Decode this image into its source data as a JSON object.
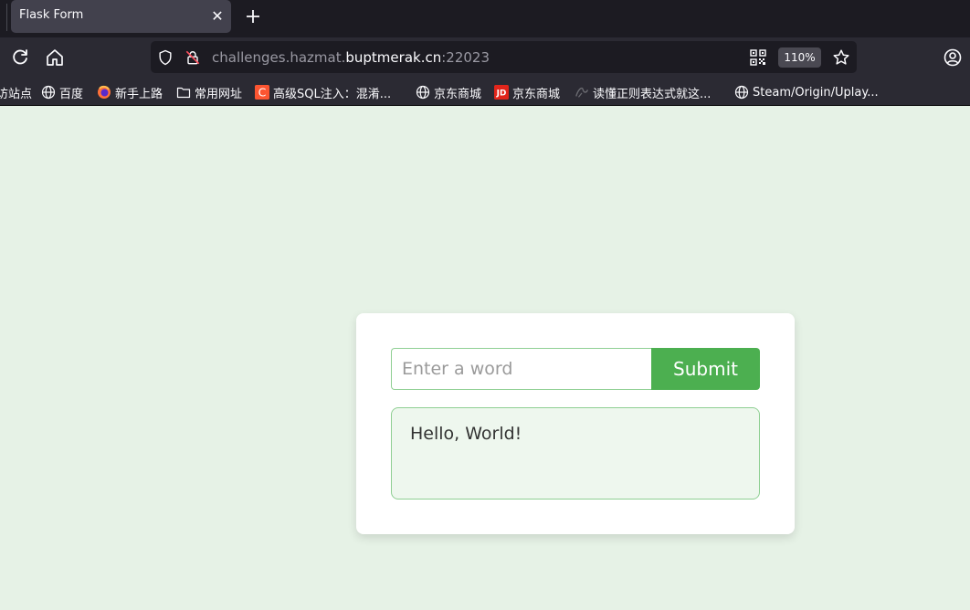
{
  "browser": {
    "tab_title": "Flask Form",
    "tab_close_glyph": "✕",
    "url": {
      "prefix": "challenges.hazmat.",
      "host": "buptmerak.cn",
      "port": ":22023"
    },
    "zoom_level": "110%",
    "bookmarks": [
      {
        "label": "访站点",
        "icon": "none"
      },
      {
        "label": "百度",
        "icon": "globe-icon"
      },
      {
        "label": "新手上路",
        "icon": "firefox-icon"
      },
      {
        "label": "常用网址",
        "icon": "folder-icon"
      },
      {
        "label": "高级SQL注入：混淆...",
        "icon": "csdn-icon"
      },
      {
        "label": "京东商城",
        "icon": "globe-icon"
      },
      {
        "label": "京东商城",
        "icon": "jd-icon"
      },
      {
        "label": "读懂正则表达式就这...",
        "icon": "regex-icon"
      },
      {
        "label": "Steam/Origin/Uplay...",
        "icon": "globe-icon"
      }
    ]
  },
  "form": {
    "input_placeholder": "Enter a word",
    "input_value": "",
    "submit_label": "Submit"
  },
  "result": {
    "text": "Hello, World!"
  },
  "colors": {
    "page_background": "#e6f2e6",
    "accent": "#4caf50",
    "result_background": "#eef7ee"
  }
}
